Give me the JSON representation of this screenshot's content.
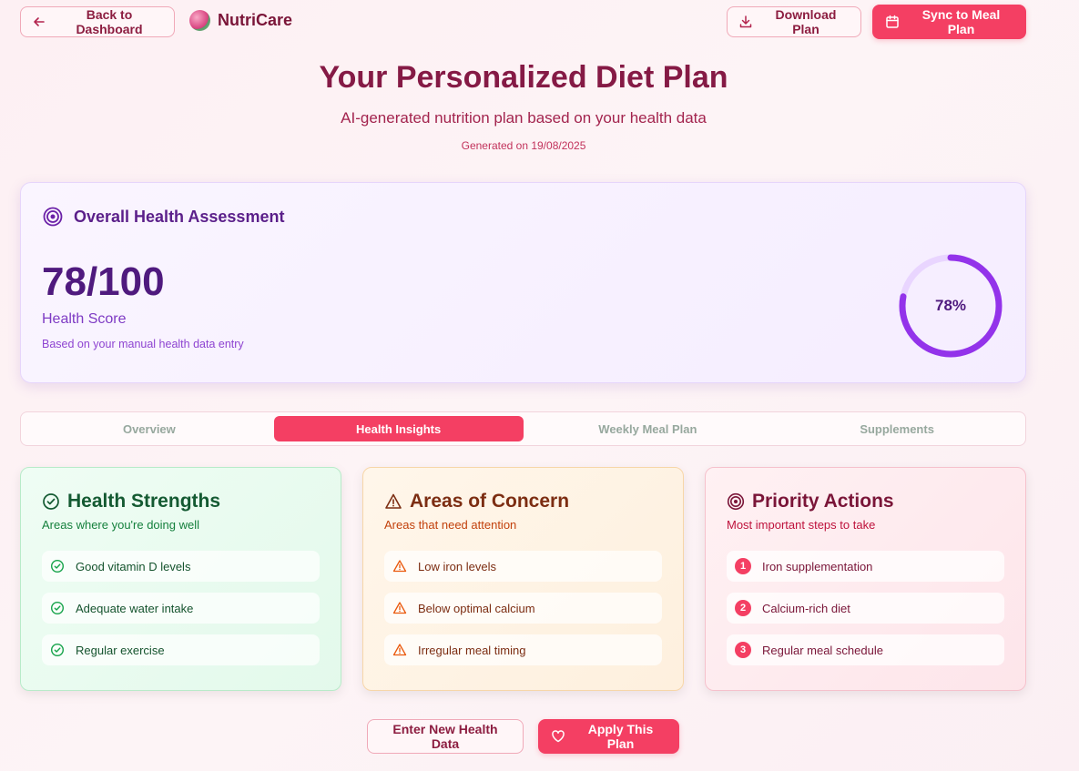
{
  "header": {
    "back_label": "Back to Dashboard",
    "brand": "NutriCare",
    "download_label": "Download Plan",
    "sync_label": "Sync to Meal Plan"
  },
  "hero": {
    "title": "Your Personalized Diet Plan",
    "subtitle": "AI-generated nutrition plan based on your health data",
    "generated": "Generated on 19/08/2025"
  },
  "assessment": {
    "title": "Overall Health Assessment",
    "score": "78/100",
    "score_label": "Health Score",
    "note": "Based on your manual health data entry",
    "percent_text": "78%",
    "percent_value": 78
  },
  "tabs": [
    {
      "label": "Overview",
      "active": false
    },
    {
      "label": "Health Insights",
      "active": true
    },
    {
      "label": "Weekly Meal Plan",
      "active": false
    },
    {
      "label": "Supplements",
      "active": false
    }
  ],
  "strengths": {
    "title": "Health Strengths",
    "subtitle": "Areas where you're doing well",
    "items": [
      "Good vitamin D levels",
      "Adequate water intake",
      "Regular exercise"
    ]
  },
  "concerns": {
    "title": "Areas of Concern",
    "subtitle": "Areas that need attention",
    "items": [
      "Low iron levels",
      "Below optimal calcium",
      "Irregular meal timing"
    ]
  },
  "priorities": {
    "title": "Priority Actions",
    "subtitle": "Most important steps to take",
    "items": [
      {
        "num": "1",
        "label": "Iron supplementation"
      },
      {
        "num": "2",
        "label": "Calcium-rich diet"
      },
      {
        "num": "3",
        "label": "Regular meal schedule"
      }
    ]
  },
  "footer": {
    "enter_label": "Enter New Health Data",
    "apply_label": "Apply This Plan"
  },
  "colors": {
    "accent": "#f43f63",
    "purple": "#9333ea",
    "green": "#16a34a",
    "orange": "#ea580c"
  },
  "icons": {
    "back": "arrow-left-icon",
    "download": "download-icon",
    "sync": "calendar-icon",
    "assessment": "target-icon",
    "strengths": "check-circle-icon",
    "concerns": "warning-triangle-icon",
    "priorities": "target-icon",
    "apply": "heart-icon"
  }
}
